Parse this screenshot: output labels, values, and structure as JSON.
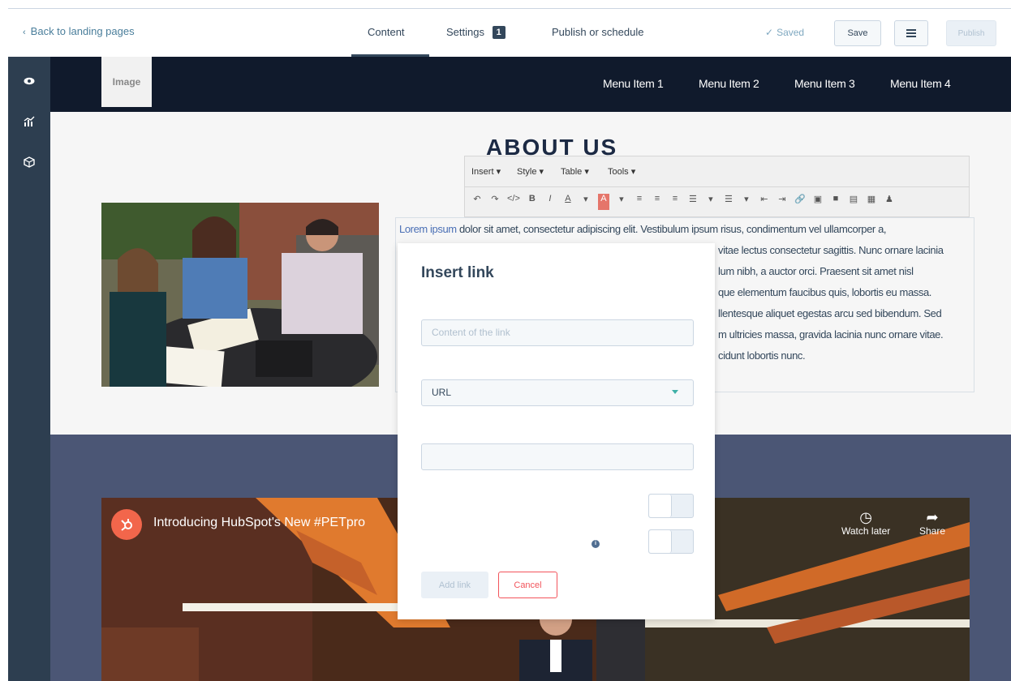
{
  "topbar": {
    "back_label": "Back to landing pages",
    "tabs": [
      {
        "label": "Content"
      },
      {
        "label": "Settings",
        "badge": "1"
      },
      {
        "label": "Publish or schedule"
      }
    ],
    "saved_label": "Saved",
    "save_label": "Save",
    "publish_label": "Publish"
  },
  "rail": {
    "icons": [
      "eye-icon",
      "analytics-icon",
      "cube-icon"
    ]
  },
  "site": {
    "logo_label": "Image",
    "menu": [
      "Menu Item 1",
      "Menu Item 2",
      "Menu Item 3",
      "Menu Item 4"
    ],
    "about_title": "ABOUT US",
    "body_lines": [
      {
        "link": "Lorem ipsum",
        "text": " dolor sit amet, consectetur adipiscing elit. Vestibulum ipsum risus, condimentum vel ullamcorper a,"
      },
      {
        "text": "vitae lectus consectetur sagittis. Nunc ornare lacinia"
      },
      {
        "text": "lum nibh, a auctor orci. Praesent sit amet nisl"
      },
      {
        "text": "que elementum faucibus quis, lobortis eu massa."
      },
      {
        "text": "llentesque aliquet egestas arcu sed bibendum. Sed"
      },
      {
        "text": "m ultricies massa, gravida lacinia nunc ornare vitae."
      },
      {
        "text": "cidunt lobortis nunc."
      }
    ]
  },
  "editor_toolbar": {
    "menus": [
      "Insert ▾",
      "Style ▾",
      "Table ▾",
      "Tools ▾"
    ]
  },
  "video": {
    "title": "Introducing HubSpot's New #PETpro",
    "watch_later": "Watch later",
    "share": "Share"
  },
  "insert_link_modal": {
    "title": "Insert link",
    "content_placeholder": "Content of the link",
    "link_type": "URL",
    "add_label": "Add link",
    "cancel_label": "Cancel"
  },
  "colors": {
    "nav_bg": "#101a2c",
    "rail_bg": "#2d3e50",
    "band_bg": "#4b5675",
    "cancel_accent": "#f2545b",
    "caret_accent": "#3eb0a7"
  }
}
